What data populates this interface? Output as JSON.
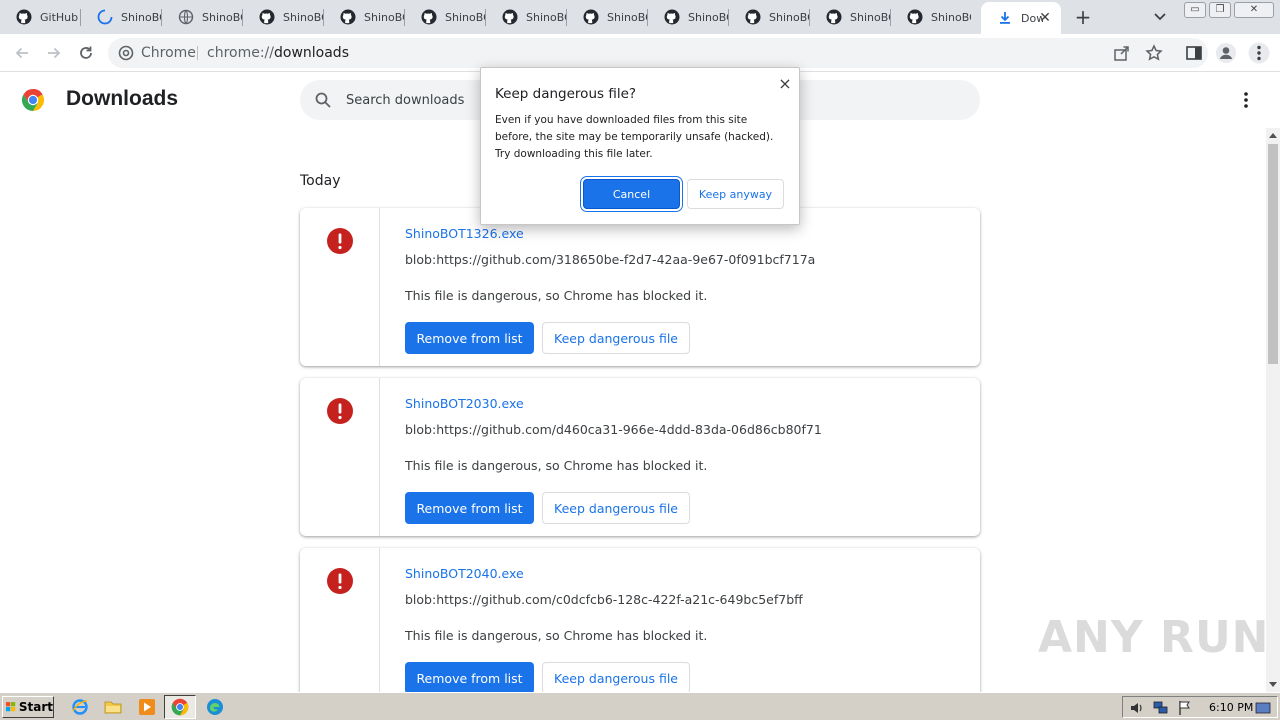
{
  "tabs": [
    {
      "title": "GitHub -",
      "icon": "github-icon"
    },
    {
      "title": "ShinoBO",
      "icon": "loading-spinner-icon"
    },
    {
      "title": "ShinoBO",
      "icon": "globe-icon"
    },
    {
      "title": "ShinoBO",
      "icon": "github-icon"
    },
    {
      "title": "ShinoBO",
      "icon": "github-icon"
    },
    {
      "title": "ShinoBO",
      "icon": "github-icon"
    },
    {
      "title": "ShinoBO",
      "icon": "github-icon"
    },
    {
      "title": "ShinoBO",
      "icon": "github-icon"
    },
    {
      "title": "ShinoBO",
      "icon": "github-icon"
    },
    {
      "title": "ShinoBO",
      "icon": "github-icon"
    },
    {
      "title": "ShinoBO",
      "icon": "github-icon"
    },
    {
      "title": "ShinoBO",
      "icon": "github-icon"
    }
  ],
  "active_tab": {
    "title": "Dow",
    "icon": "download-icon",
    "close": "✕"
  },
  "new_tab_label": "+",
  "window_controls": {
    "minimize": "▭",
    "restore": "❐",
    "close": "✕"
  },
  "omnibox": {
    "scheme_label": "Chrome",
    "url_prefix": "chrome://",
    "url_host": "downloads"
  },
  "page": {
    "title": "Downloads",
    "search_placeholder": "Search downloads",
    "section_label": "Today"
  },
  "downloads": [
    {
      "file_name": "ShinoBOT1326.exe",
      "url": "blob:https://github.com/318650be-f2d7-42aa-9e67-0f091bcf717a",
      "status": "This file is dangerous, so Chrome has blocked it.",
      "remove_label": "Remove from list",
      "keep_label": "Keep dangerous file"
    },
    {
      "file_name": "ShinoBOT2030.exe",
      "url": "blob:https://github.com/d460ca31-966e-4ddd-83da-06d86cb80f71",
      "status": "This file is dangerous, so Chrome has blocked it.",
      "remove_label": "Remove from list",
      "keep_label": "Keep dangerous file"
    },
    {
      "file_name": "ShinoBOT2040.exe",
      "url": "blob:https://github.com/c0dcfcb6-128c-422f-a21c-649bc5ef7bff",
      "status": "This file is dangerous, so Chrome has blocked it.",
      "remove_label": "Remove from list",
      "keep_label": "Keep dangerous file"
    }
  ],
  "dialog": {
    "title": "Keep dangerous file?",
    "body": "Even if you have downloaded files from this site before, the site may be temporarily unsafe (hacked). Try downloading this file later.",
    "cancel_label": "Cancel",
    "keep_label": "Keep anyway",
    "close_label": "×"
  },
  "taskbar": {
    "start_label": "Start",
    "clock": "6:10 PM",
    "quick_launch": [
      "internet-explorer-icon",
      "folder-icon",
      "media-player-icon",
      "chrome-icon",
      "edge-icon"
    ],
    "tray_icons": [
      "speaker-icon",
      "network-icon",
      "flag-icon"
    ]
  },
  "watermark": "ANY RUN",
  "colors": {
    "accent": "#1a73e8",
    "danger": "#c5221f",
    "tab_strip": "#dee1e6"
  }
}
